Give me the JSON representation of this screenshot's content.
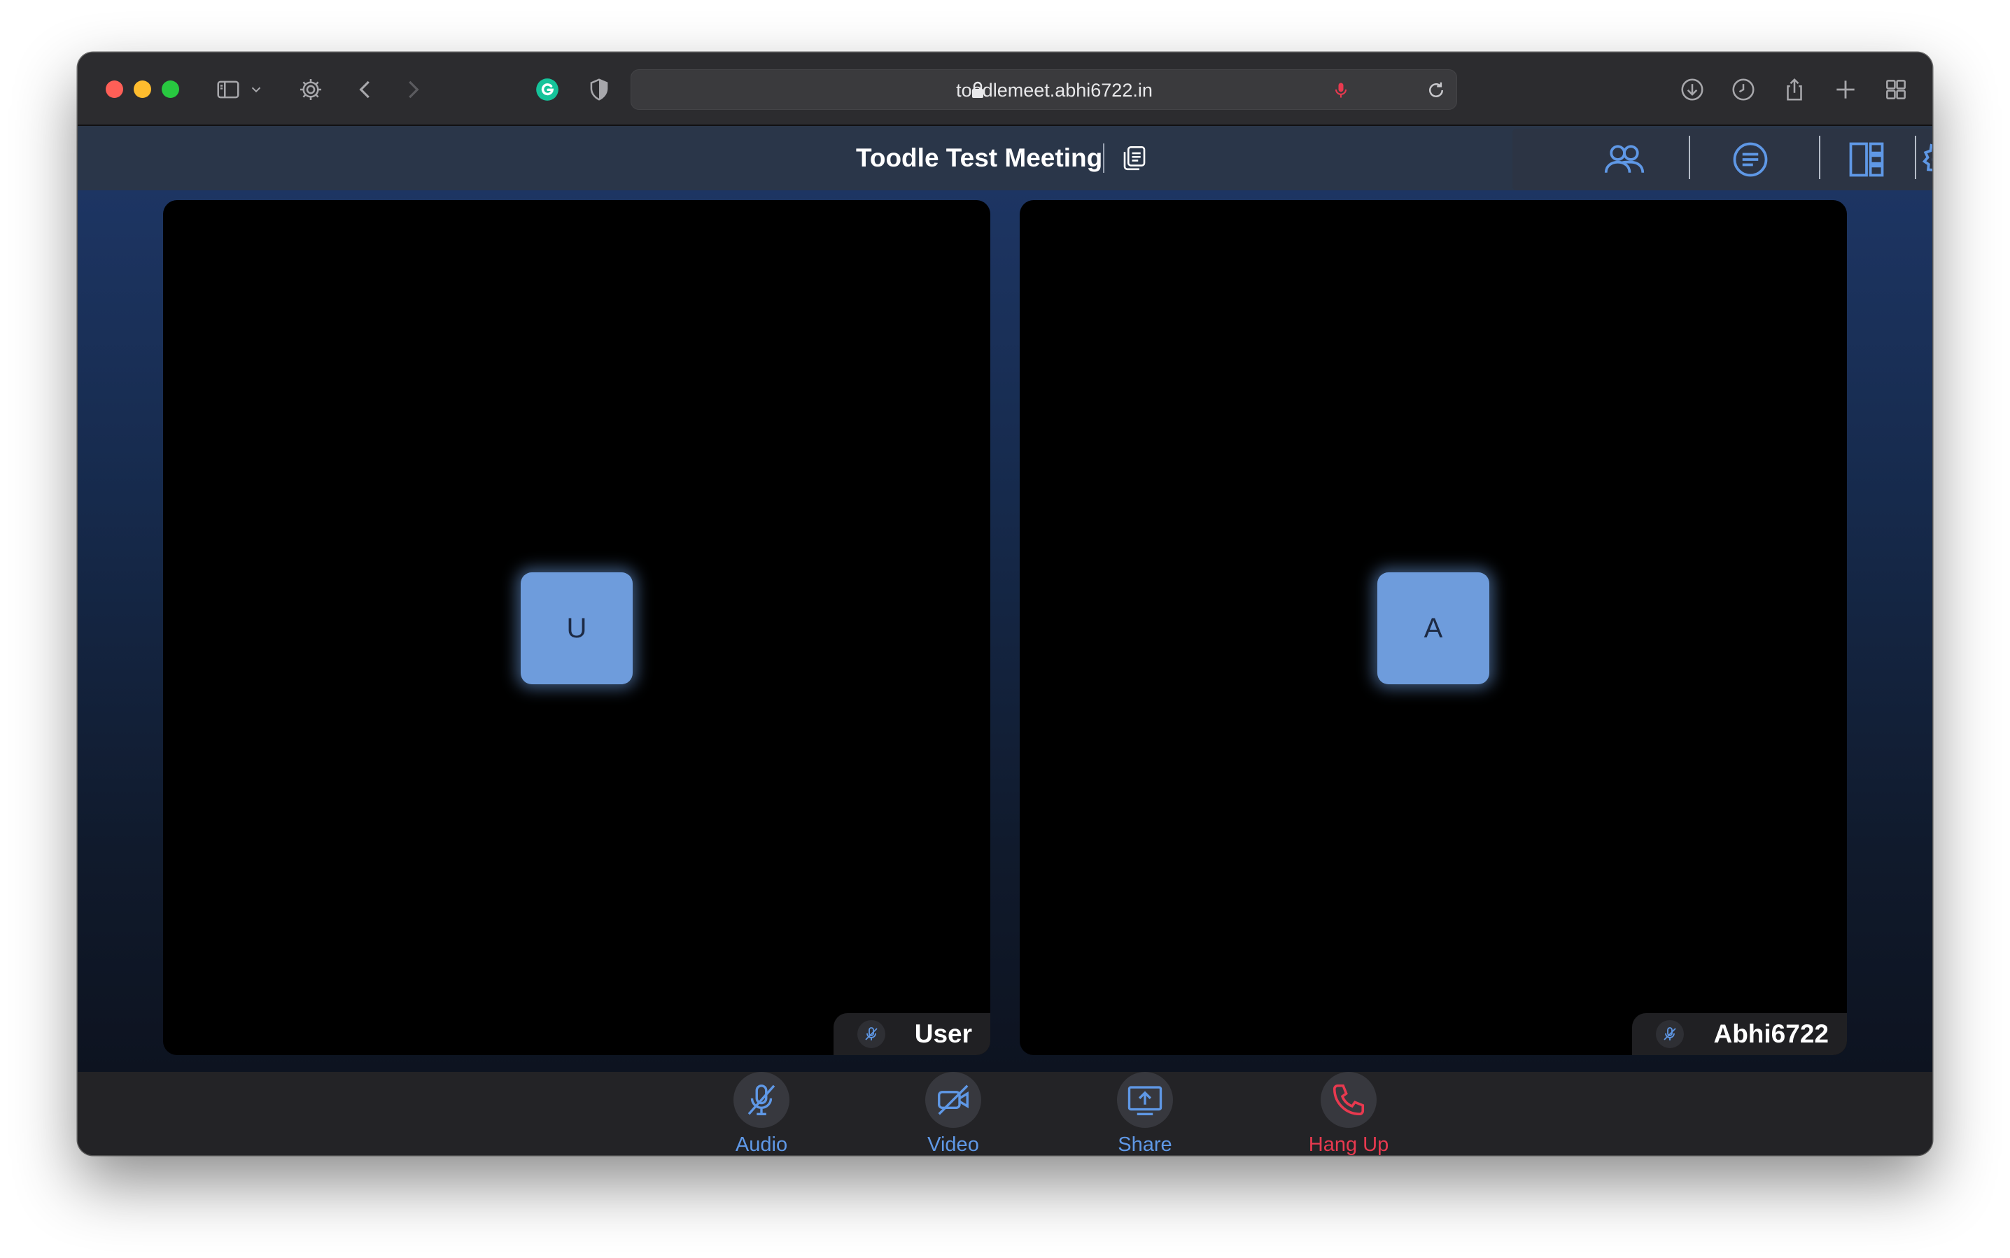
{
  "browser": {
    "url": "toodlemeet.abhi6722.in"
  },
  "meeting": {
    "title": "Toodle Test Meeting"
  },
  "participants": [
    {
      "initial": "U",
      "name": "User"
    },
    {
      "initial": "A",
      "name": "Abhi6722"
    }
  ],
  "controls": {
    "audio": "Audio",
    "video": "Video",
    "share": "Share",
    "hangup": "Hang Up"
  },
  "colors": {
    "accent": "#5f98e6",
    "danger": "#e8394f",
    "avatar": "#6e9cdc"
  }
}
